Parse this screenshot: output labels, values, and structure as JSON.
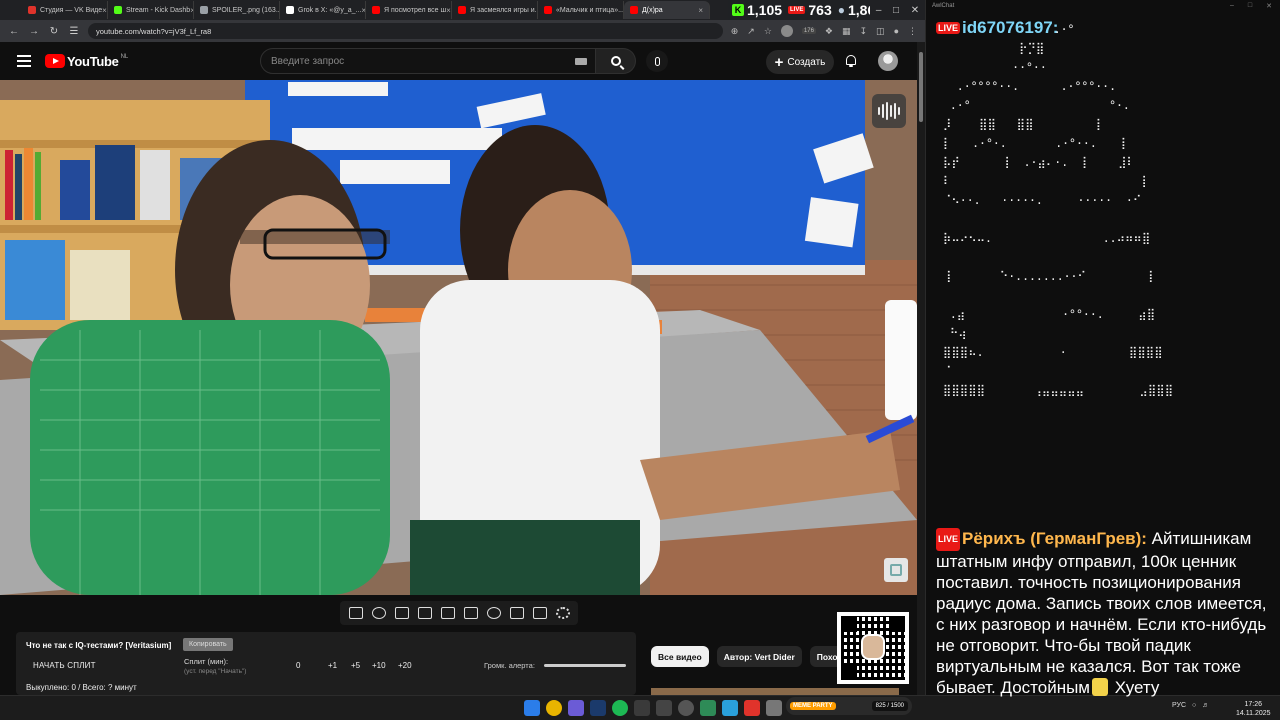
{
  "browser": {
    "tabs": [
      {
        "label": "Студия — VK Виде",
        "color": "#e0332b"
      },
      {
        "label": "Stream - Kick Dashb",
        "color": "#53fc18"
      },
      {
        "label": "SPOILER_.png (163...",
        "color": "#9aa0a6"
      },
      {
        "label": "Grok в X: «@y_a_...",
        "color": "#ffffff"
      },
      {
        "label": "Я посмотрел все ш",
        "color": "#ff0000"
      },
      {
        "label": "Я засмеялся игры и...",
        "color": "#ff0000"
      },
      {
        "label": "«Мальчик и птица»...",
        "color": "#ff0000"
      },
      {
        "label": "Д(х)ра",
        "color": "#ff0000"
      }
    ],
    "stats": {
      "kick": "1,105",
      "live": "763",
      "viewers": "1,868"
    },
    "url": "youtube.com/watch?v=jV3f_Lf_ra8",
    "ext_count": "176"
  },
  "youtube": {
    "logo_text": "YouTube",
    "region": "NL",
    "search_placeholder": "Введите запрос",
    "create_label": "Создать"
  },
  "video": {
    "title": "Что не так с IQ-тестами? [Veritasium]",
    "copy_label": "Копировать"
  },
  "split": {
    "start_label": "НАЧАТЬ СПЛИТ",
    "split_label": "Сплит (мин):",
    "split_hint": "(уст. перед \"Начать\")",
    "values": [
      "0",
      "+1",
      "+5",
      "+10",
      "+20"
    ],
    "alert_label": "Громк. алерта:",
    "footer": "Выкуплено: 0 / Всего: ? минут"
  },
  "chips": [
    "Все видео",
    "Автор: Vert Dider",
    "Похож"
  ],
  "taskbar": {
    "meme_label": "MEME PARTY",
    "meme_count": "825 / 1500",
    "lang": "РУС",
    "time": "17:26",
    "date": "14.11.2025"
  },
  "chat": {
    "window_title": "AwlChat",
    "live_badge": "LIVE",
    "user1": "id67076197:",
    "ascii_art": "                 .·°\n            ⡗⡙⣿\n           ··°··\n   .·°°°°··.      .·°°°··.\n  .·°                    °·.\n ⡸    ⣿⣿   ⣿⣿         ⡇\n ⡇   .·°·.       .·°··.   ⢸\n ⡧⡞      ⢸  .·⣴⠄·.  ⡇    ⣸⠇\n ⠇                           ⢸\n ⠈⠢··.   ·····.     ·····  ·⠊\n\n ⡷⠤⠔⠢⠤.                ..⠴⠶⠶⣿\n\n ⢸       ⠑·.......··⠊         ⡇\n\n  .⣴              ·°°··.     ⣴⣿\n  ⠓⢴\n ⣿⣿⣿⠦.           ·         ⣿⣿⣿⣿\n ⠈\n ⣿⣿⣿⣿⣿       ⢠⣤⣤⣤⣤⣤        ⣠⣿⣿⣿",
    "user2": "Рёрихъ (ГерманГрев):",
    "msg2_before": " Айтишникам штатным инфу отправил, 100к ценник поставил. точность позиционирования радиус дома. Запись твоих слов имеется, с них разговор и начнём. Если кто-нибудь не отговорит. Что-бы твой падик виртуальным не казался. Вот так тоже бывает. Достойным",
    "msg2_after": " Хуету"
  }
}
